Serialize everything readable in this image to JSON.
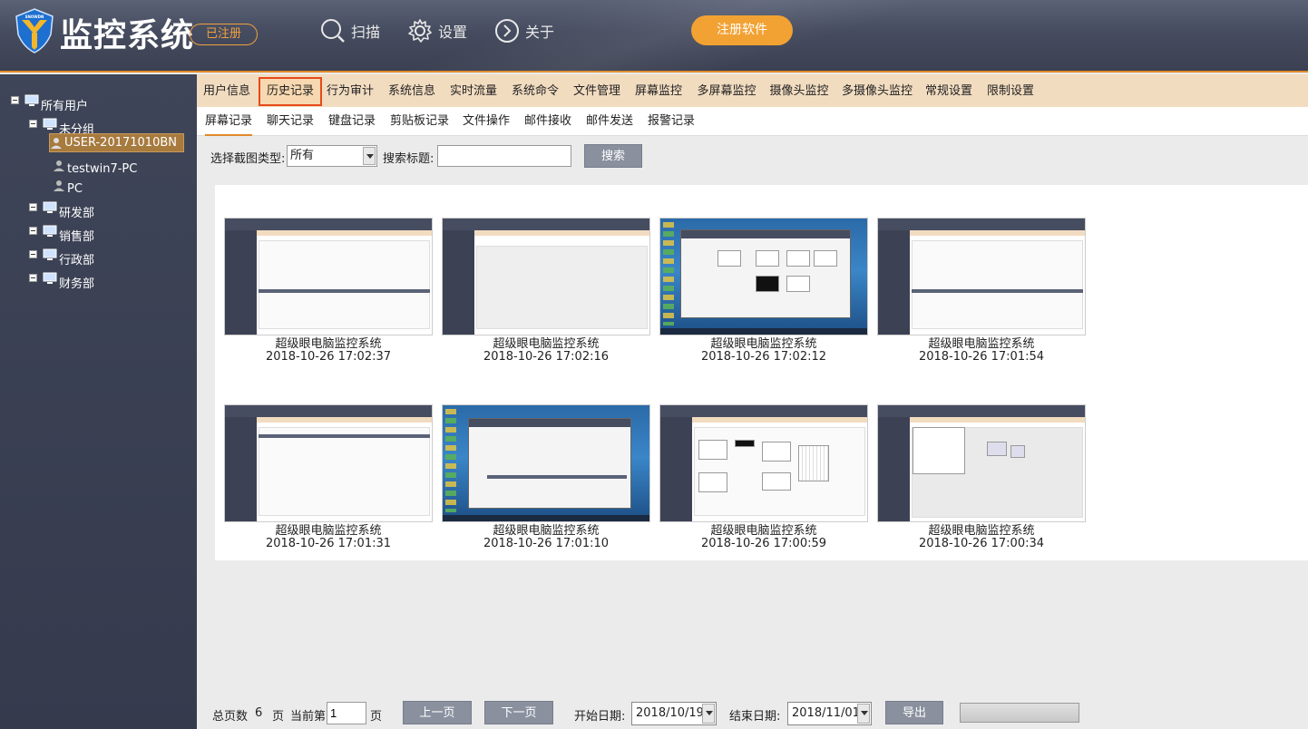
{
  "app": {
    "title": "监控系统",
    "registered_badge": "已注册",
    "logo_text": "SNOWDN",
    "register_button": "注册软件"
  },
  "top_nav": [
    {
      "label": "扫描",
      "icon": "search-icon"
    },
    {
      "label": "设置",
      "icon": "gear-icon"
    },
    {
      "label": "关于",
      "icon": "chevron-right-circle-icon"
    }
  ],
  "sidebar": {
    "root": "所有用户",
    "groups": [
      {
        "label": "未分组",
        "children": [
          "USER-20171010BN",
          "testwin7-PC",
          "PC"
        ]
      },
      {
        "label": "研发部"
      },
      {
        "label": "销售部"
      },
      {
        "label": "行政部"
      },
      {
        "label": "财务部"
      }
    ],
    "selected": "USER-20171010BN"
  },
  "tabs": [
    "用户信息",
    "历史记录",
    "行为审计",
    "系统信息",
    "实时流量",
    "系统命令",
    "文件管理",
    "屏幕监控",
    "多屏幕监控",
    "摄像头监控",
    "多摄像头监控",
    "常规设置",
    "限制设置"
  ],
  "active_tab": "历史记录",
  "subtabs": [
    "屏幕记录",
    "聊天记录",
    "键盘记录",
    "剪贴板记录",
    "文件操作",
    "邮件接收",
    "邮件发送",
    "报警记录"
  ],
  "active_subtab": "屏幕记录",
  "filter": {
    "type_label": "选择截图类型:",
    "type_value": "所有",
    "title_label": "搜索标题:",
    "title_value": "",
    "search_button": "搜索"
  },
  "screenshots": [
    {
      "title": "超级眼电脑监控系统",
      "time": "2018-10-26 17:02:37",
      "style": "app"
    },
    {
      "title": "超级眼电脑监控系统",
      "time": "2018-10-26 17:02:16",
      "style": "app"
    },
    {
      "title": "超级眼电脑监控系统",
      "time": "2018-10-26 17:02:12",
      "style": "desktop"
    },
    {
      "title": "超级眼电脑监控系统",
      "time": "2018-10-26 17:01:54",
      "style": "app"
    },
    {
      "title": "超级眼电脑监控系统",
      "time": "2018-10-26 17:01:31",
      "style": "app"
    },
    {
      "title": "超级眼电脑监控系统",
      "time": "2018-10-26 17:01:10",
      "style": "desktop"
    },
    {
      "title": "超级眼电脑监控系统",
      "time": "2018-10-26 17:00:59",
      "style": "app-gallery"
    },
    {
      "title": "超级眼电脑监控系统",
      "time": "2018-10-26 17:00:34",
      "style": "app-devices"
    }
  ],
  "pager": {
    "total_label": "总页数",
    "total_pages": "6",
    "page_unit": "页",
    "current_label": "当前第",
    "current_page": "1",
    "current_unit": "页",
    "prev_button": "上一页",
    "next_button": "下一页",
    "start_label": "开始日期:",
    "start_date": "2018/10/19",
    "end_label": "结束日期:",
    "end_date": "2018/11/01",
    "export_button": "导出"
  },
  "colors": {
    "header_bg": "#464c5f",
    "sidebar_bg": "#3a4052",
    "accent_orange": "#f2a233",
    "active_tab_border": "#e64a19",
    "tab_bar_bg": "#f2dcc0",
    "selected_node_bg": "#a77a3e"
  }
}
